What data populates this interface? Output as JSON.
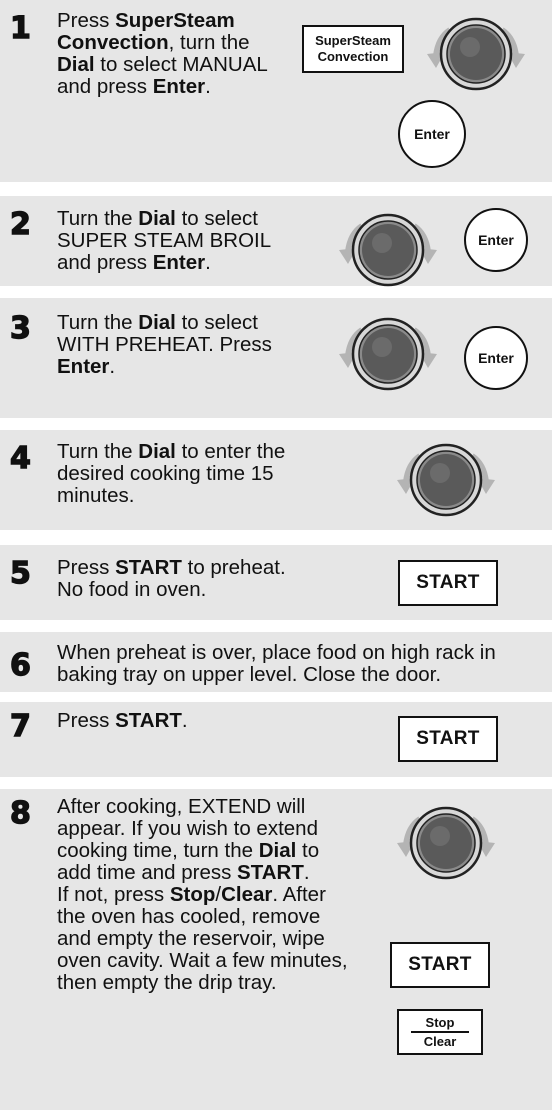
{
  "steps": [
    {
      "number": "1",
      "segments": [
        {
          "t": "Press ",
          "b": false
        },
        {
          "t": "SuperSteam Convection",
          "b": true
        },
        {
          "t": ", turn the ",
          "b": false
        },
        {
          "t": "Dial",
          "b": true
        },
        {
          "t": " to select MANUAL and press ",
          "b": false
        },
        {
          "t": "Enter",
          "b": true
        },
        {
          "t": ".",
          "b": false
        }
      ]
    },
    {
      "number": "2",
      "segments": [
        {
          "t": "Turn the ",
          "b": false
        },
        {
          "t": "Dial",
          "b": true
        },
        {
          "t": " to select SUPER STEAM BROIL and press ",
          "b": false
        },
        {
          "t": "Enter",
          "b": true
        },
        {
          "t": ".",
          "b": false
        }
      ]
    },
    {
      "number": "3",
      "segments": [
        {
          "t": "Turn the ",
          "b": false
        },
        {
          "t": "Dial",
          "b": true
        },
        {
          "t": " to select WITH PREHEAT. Press ",
          "b": false
        },
        {
          "t": "Enter",
          "b": true
        },
        {
          "t": ".",
          "b": false
        }
      ]
    },
    {
      "number": "4",
      "segments": [
        {
          "t": "Turn the ",
          "b": false
        },
        {
          "t": "Dial",
          "b": true
        },
        {
          "t": " to enter the desired cooking time 15 minutes.",
          "b": false
        }
      ]
    },
    {
      "number": "5",
      "segments": [
        {
          "t": "Press ",
          "b": false
        },
        {
          "t": "START",
          "b": true
        },
        {
          "t": " to preheat.",
          "b": false
        },
        {
          "br": true
        },
        {
          "t": "No food in oven.",
          "b": false
        }
      ]
    },
    {
      "number": "6",
      "segments": [
        {
          "t": "When preheat is over, place food on high rack in baking tray on upper level. Close the door.",
          "b": false
        }
      ]
    },
    {
      "number": "7",
      "segments": [
        {
          "t": "Press ",
          "b": false
        },
        {
          "t": "START",
          "b": true
        },
        {
          "t": ".",
          "b": false
        }
      ]
    },
    {
      "number": "8",
      "segments": [
        {
          "t": "After cooking, EXTEND will appear. If you wish to extend cooking time, turn the ",
          "b": false
        },
        {
          "t": "Dial",
          "b": true
        },
        {
          "t": " to add time and press ",
          "b": false
        },
        {
          "t": "START",
          "b": true
        },
        {
          "t": ".",
          "b": false
        },
        {
          "br": true
        },
        {
          "t": "If not, press ",
          "b": false
        },
        {
          "t": "Stop",
          "b": true
        },
        {
          "t": "/",
          "b": false
        },
        {
          "t": "Clear",
          "b": true
        },
        {
          "t": ". After the oven has cooled, remove and empty the reservoir, wipe oven cavity. Wait a few minutes, then empty the drip tray.",
          "b": false
        }
      ]
    }
  ],
  "buttons": {
    "supersteam_line1": "SuperSteam",
    "supersteam_line2": "Convection",
    "enter": "Enter",
    "start": "START",
    "stop": "Stop",
    "clear": "Clear"
  },
  "colors": {
    "panel_background": "#e6e6e6",
    "dial_knob": "#5a5a5a",
    "arrow": "#b4b4b4"
  }
}
